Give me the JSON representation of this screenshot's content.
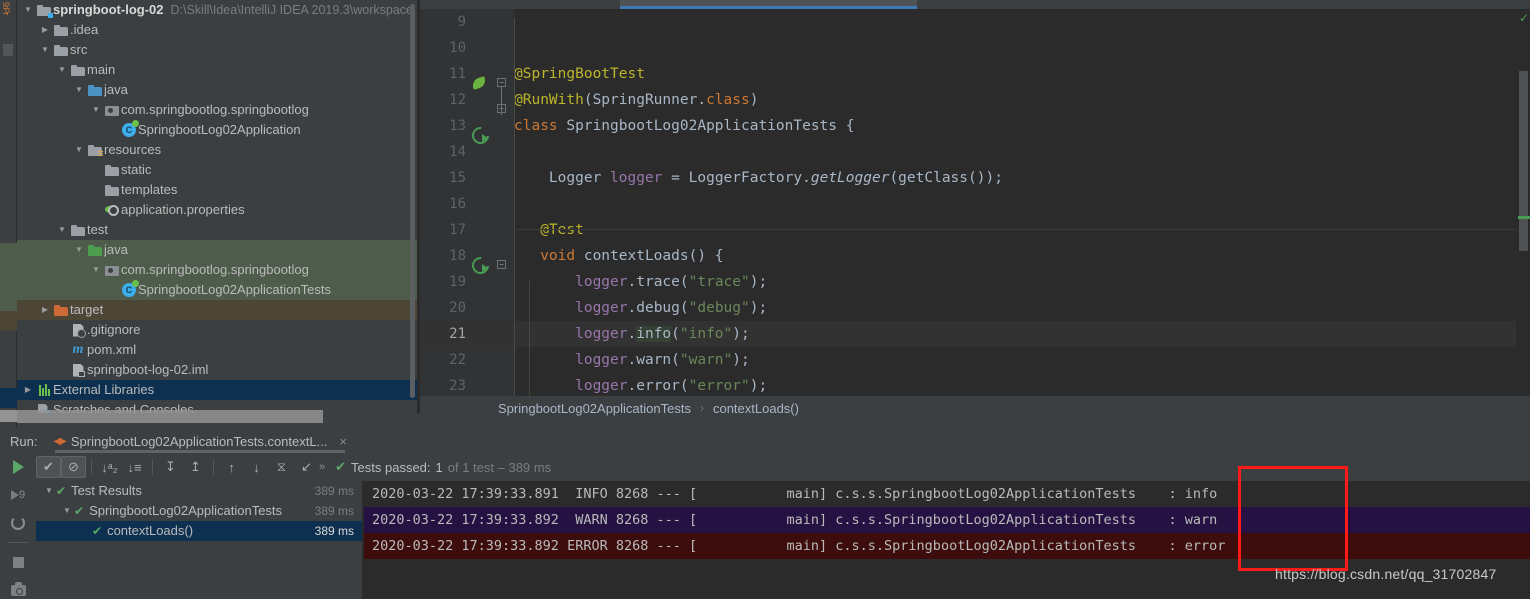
{
  "project": {
    "root_label": "springboot-log-02",
    "root_path": "D:\\Skill\\Idea\\IntelliJ IDEA 2019.3\\workspace",
    "items": [
      {
        "label": ".idea",
        "indent": 1,
        "arrow": "▶",
        "icon": "folder-grey"
      },
      {
        "label": "src",
        "indent": 1,
        "arrow": "▼",
        "icon": "folder-grey"
      },
      {
        "label": "main",
        "indent": 2,
        "arrow": "▼",
        "icon": "folder-grey"
      },
      {
        "label": "java",
        "indent": 3,
        "arrow": "▼",
        "icon": "folder-blue"
      },
      {
        "label": "com.springbootlog.springbootlog",
        "indent": 4,
        "arrow": "▼",
        "icon": "package"
      },
      {
        "label": "SpringbootLog02Application",
        "indent": 5,
        "arrow": "",
        "icon": "class-spring"
      },
      {
        "label": "resources",
        "indent": 3,
        "arrow": "▼",
        "icon": "folder-resources"
      },
      {
        "label": "static",
        "indent": 4,
        "arrow": "",
        "icon": "folder-grey"
      },
      {
        "label": "templates",
        "indent": 4,
        "arrow": "",
        "icon": "folder-grey"
      },
      {
        "label": "application.properties",
        "indent": 4,
        "arrow": "",
        "icon": "properties"
      },
      {
        "label": "test",
        "indent": 2,
        "arrow": "▼",
        "icon": "folder-grey"
      },
      {
        "label": "java",
        "indent": 3,
        "arrow": "▼",
        "icon": "folder-green",
        "hl": "green"
      },
      {
        "label": "com.springbootlog.springbootlog",
        "indent": 4,
        "arrow": "▼",
        "icon": "package",
        "hl": "green"
      },
      {
        "label": "SpringbootLog02ApplicationTests",
        "indent": 5,
        "arrow": "",
        "icon": "class-test",
        "hl": "green"
      },
      {
        "label": "target",
        "indent": 1,
        "arrow": "▶",
        "icon": "folder-orange",
        "hl": "brown"
      },
      {
        "label": ".gitignore",
        "indent": 2,
        "arrow": "",
        "icon": "file-git"
      },
      {
        "label": "pom.xml",
        "indent": 2,
        "arrow": "",
        "icon": "maven"
      },
      {
        "label": "springboot-log-02.iml",
        "indent": 2,
        "arrow": "",
        "icon": "file-iml"
      },
      {
        "label": "External Libraries",
        "indent": 0,
        "arrow": "▶",
        "icon": "libraries",
        "hl": "blue"
      },
      {
        "label": "Scratches and Consoles",
        "indent": 0,
        "arrow": "",
        "icon": "scratches"
      }
    ]
  },
  "editor": {
    "lines": [
      {
        "num": "9",
        "tokens": []
      },
      {
        "num": "10",
        "tokens": []
      },
      {
        "num": "11",
        "gutter": "spring-leaf",
        "fold": "start",
        "tokens": [
          {
            "t": "@SpringBootTest",
            "c": "ann"
          }
        ]
      },
      {
        "num": "12",
        "fold": "start",
        "tokens": [
          {
            "t": "@RunWith",
            "c": "ann"
          },
          {
            "t": "(",
            "c": "brc"
          },
          {
            "t": "SpringRunner",
            "c": "cls"
          },
          {
            "t": ".",
            "c": "brc"
          },
          {
            "t": "class",
            "c": "kw"
          },
          {
            "t": ")",
            "c": "brc"
          }
        ]
      },
      {
        "num": "13",
        "gutter": "run-test",
        "tokens": [
          {
            "t": "class ",
            "c": "kw"
          },
          {
            "t": "SpringbootLog02ApplicationTests ",
            "c": "cls"
          },
          {
            "t": "{",
            "c": "brc"
          }
        ]
      },
      {
        "num": "14",
        "tokens": []
      },
      {
        "num": "15",
        "tokens": [
          {
            "t": "    Logger ",
            "c": "cls"
          },
          {
            "t": "logger",
            "c": "fld"
          },
          {
            "t": " = ",
            "c": "brc"
          },
          {
            "t": "LoggerFactory",
            "c": "cls"
          },
          {
            "t": ".",
            "c": "brc"
          },
          {
            "t": "getLogger",
            "c": "stat"
          },
          {
            "t": "(",
            "c": "brc"
          },
          {
            "t": "getClass",
            "c": "cls"
          },
          {
            "t": "())",
            "c": "brc"
          },
          {
            "t": ";",
            "c": "brc"
          }
        ]
      },
      {
        "num": "16",
        "tokens": []
      },
      {
        "num": "17",
        "tokens": [
          {
            "t": "   @Test",
            "c": "ann"
          }
        ]
      },
      {
        "num": "18",
        "gutter": "run-test",
        "fold": "start",
        "tokens": [
          {
            "t": "   void ",
            "c": "kw"
          },
          {
            "t": "contextLoads",
            "c": "cls"
          },
          {
            "t": "() {",
            "c": "brc"
          }
        ]
      },
      {
        "num": "19",
        "tokens": [
          {
            "t": "       logger",
            "c": "fld"
          },
          {
            "t": ".",
            "c": "brc"
          },
          {
            "t": "trace",
            "c": "cls"
          },
          {
            "t": "(",
            "c": "brc"
          },
          {
            "t": "\"trace\"",
            "c": "str"
          },
          {
            "t": ");",
            "c": "brc"
          }
        ]
      },
      {
        "num": "20",
        "tokens": [
          {
            "t": "       logger",
            "c": "fld"
          },
          {
            "t": ".",
            "c": "brc"
          },
          {
            "t": "debug",
            "c": "cls"
          },
          {
            "t": "(",
            "c": "brc"
          },
          {
            "t": "\"debug\"",
            "c": "str"
          },
          {
            "t": ");",
            "c": "brc"
          }
        ]
      },
      {
        "num": "21",
        "current": true,
        "tokens": [
          {
            "t": "       logger",
            "c": "fld"
          },
          {
            "t": ".",
            "c": "brc"
          },
          {
            "t": "info",
            "c": "cls",
            "hl": true
          },
          {
            "t": "(",
            "c": "brc"
          },
          {
            "t": "\"info\"",
            "c": "str"
          },
          {
            "t": ");",
            "c": "brc"
          }
        ]
      },
      {
        "num": "22",
        "tokens": [
          {
            "t": "       logger",
            "c": "fld"
          },
          {
            "t": ".",
            "c": "brc"
          },
          {
            "t": "warn",
            "c": "cls"
          },
          {
            "t": "(",
            "c": "brc"
          },
          {
            "t": "\"warn\"",
            "c": "str"
          },
          {
            "t": ");",
            "c": "brc"
          }
        ]
      },
      {
        "num": "23",
        "tokens": [
          {
            "t": "       logger",
            "c": "fld"
          },
          {
            "t": ".",
            "c": "brc"
          },
          {
            "t": "error",
            "c": "cls"
          },
          {
            "t": "(",
            "c": "brc"
          },
          {
            "t": "\"error\"",
            "c": "str"
          },
          {
            "t": ");",
            "c": "brc"
          }
        ]
      }
    ]
  },
  "breadcrumb": {
    "class": "SpringbootLog02ApplicationTests",
    "separator": "›",
    "method": "contextLoads()"
  },
  "run_window": {
    "label": "Run:",
    "tab_title": "SpringbootLog02ApplicationTests.contextL...",
    "close_label": "×",
    "toolbar": [
      {
        "name": "show-passed-toggle",
        "glyph": "✔",
        "active": true
      },
      {
        "name": "hide-ignored-toggle",
        "glyph": "⊘",
        "active": true
      },
      {
        "name": "sort-alphabetically",
        "glyph": "↓ᵃ₂"
      },
      {
        "name": "sort-by-duration",
        "glyph": "↓≡"
      },
      {
        "name": "expand-all",
        "glyph": "↧"
      },
      {
        "name": "collapse-all",
        "glyph": "↥"
      },
      {
        "name": "previous-failed-test",
        "glyph": "↑"
      },
      {
        "name": "next-failed-test",
        "glyph": "↓"
      },
      {
        "name": "test-history",
        "glyph": "⧖"
      },
      {
        "name": "export-test-results",
        "glyph": "↙"
      }
    ],
    "overflow_glyph": "»",
    "status": {
      "check": "✔",
      "passed_label": "Tests passed: ",
      "passed_count": "1",
      "suffix": " of 1 test – 389 ms"
    },
    "left_toolbar": [
      {
        "name": "rerun-button",
        "glyph": "play"
      },
      {
        "name": "rerun-failed-button",
        "glyph": "rerun-failed"
      },
      {
        "name": "toggle-auto-test",
        "glyph": "auto-test"
      },
      {
        "name": "stop-button",
        "glyph": "stop"
      },
      {
        "name": "screenshot-button",
        "glyph": "camera"
      }
    ]
  },
  "test_tree": [
    {
      "label": "Test Results",
      "indent": 0,
      "arrow": "▼",
      "duration": "389 ms",
      "selected": false
    },
    {
      "label": "SpringbootLog02ApplicationTests",
      "indent": 1,
      "arrow": "▼",
      "duration": "389 ms",
      "selected": false
    },
    {
      "label": "contextLoads()",
      "indent": 2,
      "arrow": "",
      "duration": "389 ms",
      "selected": true
    }
  ],
  "console": {
    "lines": [
      {
        "level": "info",
        "text": "2020-03-22 17:39:33.891  INFO 8268 --- [           main] c.s.s.SpringbootLog02ApplicationTests    : info"
      },
      {
        "level": "warn",
        "text": "2020-03-22 17:39:33.892  WARN 8268 --- [           main] c.s.s.SpringbootLog02ApplicationTests    : warn"
      },
      {
        "level": "error",
        "text": "2020-03-22 17:39:33.892 ERROR 8268 --- [           main] c.s.s.SpringbootLog02ApplicationTests    : error"
      }
    ]
  },
  "annotation": {
    "highlight_color": "#ff1a1a"
  },
  "watermark": "https://blog.csdn.net/qq_31702847"
}
